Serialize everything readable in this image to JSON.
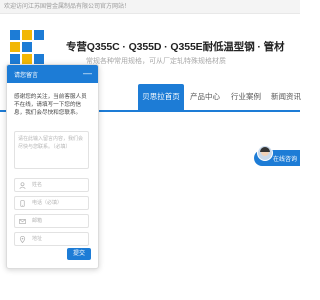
{
  "topbar": {
    "text": "欢迎访问江苏国营金属制品有限公司官方网站！"
  },
  "header": {
    "title": "专营Q355C · Q355D · Q355E耐低温型钢 · 管材",
    "subtitle": "常规各种常用规格，可从厂定轧特殊规格材质"
  },
  "nav": {
    "items": [
      {
        "label": "贝思拉首页"
      },
      {
        "label": "产品中心"
      },
      {
        "label": "行业案例"
      },
      {
        "label": "新闻资讯"
      }
    ],
    "active_index": 0
  },
  "online": {
    "label": "在线咨询"
  },
  "chat": {
    "title": "请您留言",
    "minimize_symbol": "—",
    "message": "感谢您的关注，当前客服人员不在线，请填写一下您的信息，我们会尽快和您联系。",
    "textarea_placeholder": "请在此输入留言内容，我们会尽快与您联系。（必填）",
    "fields": [
      {
        "placeholder": "姓名",
        "icon": "user-icon"
      },
      {
        "placeholder": "电话（必填）",
        "icon": "phone-icon"
      },
      {
        "placeholder": "邮箱",
        "icon": "mail-icon"
      },
      {
        "placeholder": "地址",
        "icon": "location-icon"
      }
    ],
    "send_label": "提交"
  },
  "colors": {
    "accent": "#1d7cd6",
    "logo_yellow": "#f2b705",
    "logo_blue": "#1d7cd6"
  }
}
